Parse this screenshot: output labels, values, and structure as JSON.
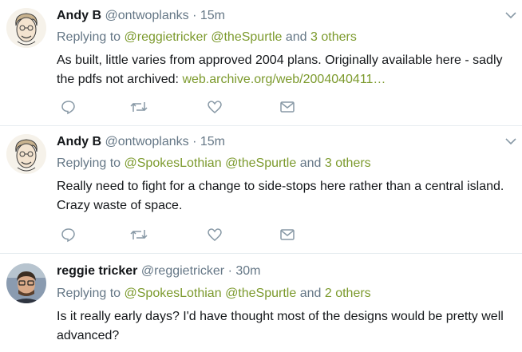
{
  "colors": {
    "link": "#7c9a2d",
    "muted": "#657786",
    "text": "#14171a",
    "divider": "#e6ecf0"
  },
  "tweets": [
    {
      "author_name": "Andy B",
      "handle": "@ontwoplanks",
      "separator": "·",
      "time": "15m",
      "reply_prefix": "Replying to",
      "reply_to": [
        "@reggietricker",
        "@theSpurtle"
      ],
      "reply_and": "and",
      "reply_others": "3 others",
      "text": "As built, little varies from approved 2004 plans. Originally available here - sadly the pdfs not archived: ",
      "link": "web.archive.org/web/2004040411…",
      "icons": [
        "reply-icon",
        "retweet-icon",
        "like-icon",
        "message-icon"
      ]
    },
    {
      "author_name": "Andy B",
      "handle": "@ontwoplanks",
      "separator": "·",
      "time": "15m",
      "reply_prefix": "Replying to",
      "reply_to": [
        "@SpokesLothian",
        "@theSpurtle"
      ],
      "reply_and": "and",
      "reply_others": "3 others",
      "text": "Really need to fight for a change to side-stops here rather than a central island. Crazy waste of space.",
      "icons": [
        "reply-icon",
        "retweet-icon",
        "like-icon",
        "message-icon"
      ]
    },
    {
      "author_name": "reggie tricker",
      "handle": "@reggietricker",
      "separator": "·",
      "time": "30m",
      "reply_prefix": "Replying to",
      "reply_to": [
        "@SpokesLothian",
        "@theSpurtle"
      ],
      "reply_and": "and",
      "reply_others": "2 others",
      "text": "Is it really early days? I'd have thought most of the designs would be pretty well advanced?"
    }
  ]
}
